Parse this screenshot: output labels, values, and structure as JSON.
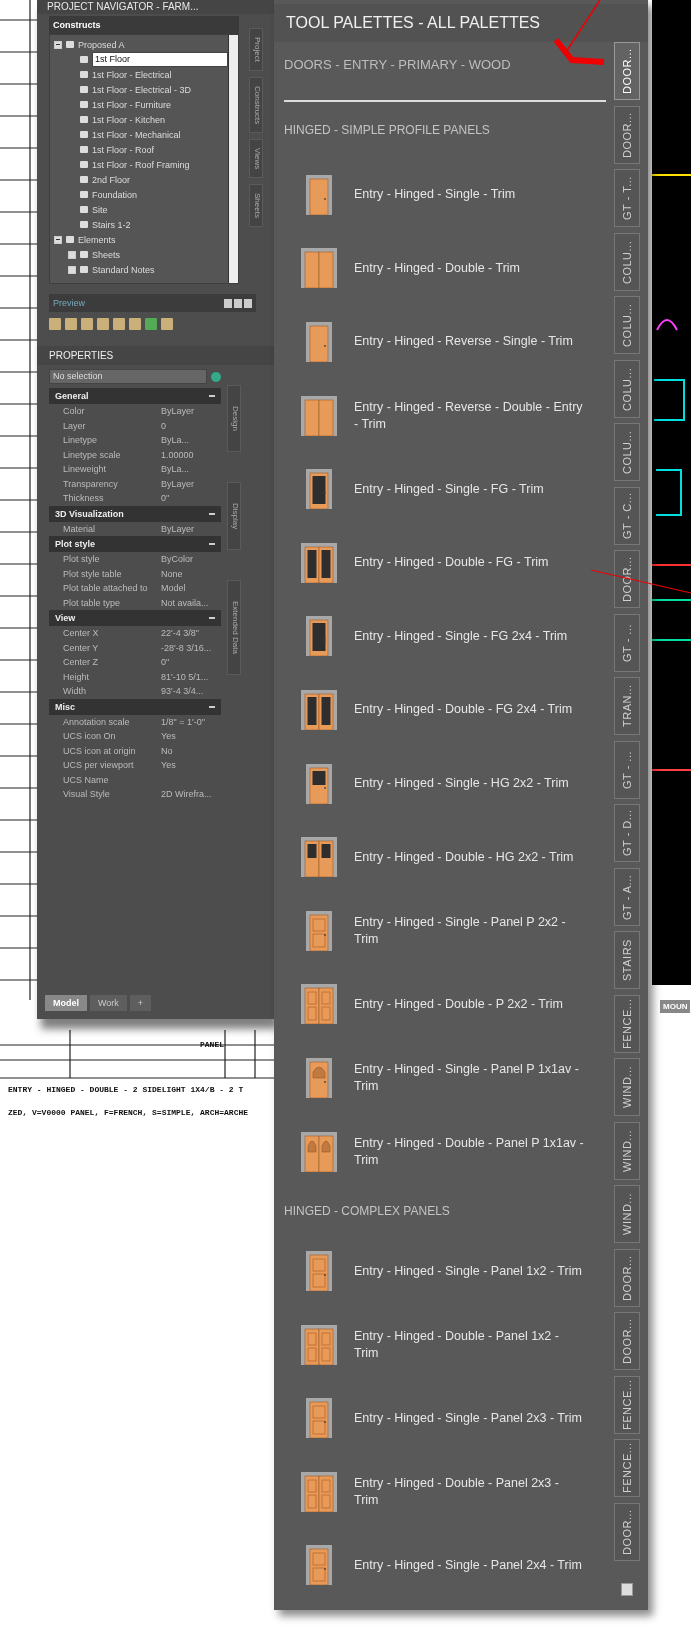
{
  "navigator": {
    "title": "PROJECT NAVIGATOR - FARM...",
    "tab": "Constructs",
    "tree": [
      {
        "label": "Proposed A",
        "expanded": true,
        "selected": false,
        "children": [
          {
            "label": "1st Floor",
            "selected": true
          },
          {
            "label": "1st Floor - Electrical",
            "selected": false
          },
          {
            "label": "1st Floor - Electrical - 3D",
            "selected": false
          },
          {
            "label": "1st Floor - Furniture",
            "selected": false
          },
          {
            "label": "1st Floor - Kitchen",
            "selected": false
          },
          {
            "label": "1st Floor - Mechanical",
            "selected": false
          },
          {
            "label": "1st Floor - Roof",
            "selected": false
          },
          {
            "label": "1st Floor - Roof Framing",
            "selected": false
          },
          {
            "label": "2nd Floor",
            "selected": false
          },
          {
            "label": "Foundation",
            "selected": false
          },
          {
            "label": "Site",
            "selected": false
          },
          {
            "label": "Stairs 1-2",
            "selected": false
          }
        ]
      },
      {
        "label": "Elements",
        "expanded": true,
        "selected": false,
        "children": [
          {
            "label": "Sheets",
            "expanded": false,
            "selected": false
          },
          {
            "label": "Standard Notes",
            "expanded": false,
            "selected": false
          }
        ]
      }
    ],
    "side_tabs": [
      "Project",
      "Constructs",
      "Views",
      "Sheets"
    ],
    "preview": "Preview"
  },
  "properties": {
    "title": "PROPERTIES",
    "selection": "No selection",
    "sections": [
      {
        "name": "General",
        "expanded": true,
        "rows": [
          [
            "Color",
            "ByLayer"
          ],
          [
            "Layer",
            "0"
          ],
          [
            "Linetype",
            "ByLa..."
          ],
          [
            "Linetype scale",
            "1.00000"
          ],
          [
            "Lineweight",
            "ByLa..."
          ],
          [
            "Transparency",
            "ByLayer"
          ],
          [
            "Thickness",
            "0\""
          ]
        ]
      },
      {
        "name": "3D Visualization",
        "expanded": true,
        "rows": [
          [
            "Material",
            "ByLayer"
          ]
        ]
      },
      {
        "name": "Plot style",
        "expanded": true,
        "rows": [
          [
            "Plot style",
            "ByColor"
          ],
          [
            "Plot style table",
            "None"
          ],
          [
            "Plot table attached to",
            "Model"
          ],
          [
            "Plot table type",
            "Not availa..."
          ]
        ]
      },
      {
        "name": "View",
        "expanded": true,
        "rows": [
          [
            "Center X",
            "22'-4 3/8\""
          ],
          [
            "Center Y",
            "-28'-8 3/16..."
          ],
          [
            "Center Z",
            "0\""
          ],
          [
            "Height",
            "81'-10 5/1..."
          ],
          [
            "Width",
            "93'-4 3/4..."
          ]
        ]
      },
      {
        "name": "Misc",
        "expanded": true,
        "rows": [
          [
            "Annotation scale",
            "1/8\" = 1'-0\""
          ],
          [
            "UCS icon On",
            "Yes"
          ],
          [
            "UCS icon at origin",
            "No"
          ],
          [
            "UCS per viewport",
            "Yes"
          ],
          [
            "UCS Name",
            ""
          ],
          [
            "Visual Style",
            "2D Wirefra..."
          ]
        ]
      }
    ],
    "side_tabs": [
      "Design",
      "Display",
      "Extended Data"
    ],
    "layout_tabs": [
      {
        "label": "Model",
        "selected": true
      },
      {
        "label": "Work",
        "selected": false
      },
      {
        "label": "+",
        "selected": false
      }
    ]
  },
  "cad_texts": [
    "PANEL",
    "ENTRY - HINGED - DOUBLE - 2 SIDELIGHT 1X4/B - 2 T",
    "ZED, V=V0000 PANEL, F=FRENCH, S=SIMPLE, ARCH=ARCHE",
    "MOUN"
  ],
  "palette": {
    "title": "TOOL PALETTES - ALL PALETTES",
    "name": "DOORS - ENTRY - PRIMARY - WOOD",
    "groups": [
      {
        "header": "HINGED - SIMPLE PROFILE PANELS",
        "items": [
          {
            "label": "Entry - Hinged - Single - Trim",
            "kind": "single"
          },
          {
            "label": "Entry - Hinged - Double - Trim",
            "kind": "double"
          },
          {
            "label": "Entry - Hinged - Reverse - Single - Trim",
            "kind": "single"
          },
          {
            "label": "Entry - Hinged - Reverse - Double - Entry - Trim",
            "kind": "double"
          },
          {
            "label": "Entry - Hinged - Single - FG - Trim",
            "kind": "single-glass"
          },
          {
            "label": "Entry - Hinged - Double - FG - Trim",
            "kind": "double-glass"
          },
          {
            "label": "Entry - Hinged - Single - FG 2x4 - Trim",
            "kind": "single-glass"
          },
          {
            "label": "Entry - Hinged - Double - FG 2x4 - Trim",
            "kind": "double-glass"
          },
          {
            "label": "Entry - Hinged - Single - HG 2x2 - Trim",
            "kind": "single-halfglass"
          },
          {
            "label": "Entry - Hinged - Double - HG 2x2 - Trim",
            "kind": "double-halfglass"
          },
          {
            "label": "Entry - Hinged - Single - Panel P 2x2 - Trim",
            "kind": "single-panel"
          },
          {
            "label": "Entry - Hinged - Double - P 2x2 - Trim",
            "kind": "double-panel"
          },
          {
            "label": "Entry - Hinged - Single - Panel P 1x1av - Trim",
            "kind": "single-arch"
          },
          {
            "label": "Entry - Hinged - Double - Panel P 1x1av - Trim",
            "kind": "double-arch"
          }
        ]
      },
      {
        "header": "HINGED - COMPLEX PANELS",
        "items": [
          {
            "label": "Entry - Hinged - Single - Panel 1x2 - Trim",
            "kind": "single-panel"
          },
          {
            "label": "Entry - Hinged - Double - Panel 1x2 - Trim",
            "kind": "double-panel"
          },
          {
            "label": "Entry - Hinged - Single - Panel 2x3 - Trim",
            "kind": "single-panel"
          },
          {
            "label": "Entry - Hinged - Double - Panel 2x3 - Trim",
            "kind": "double-panel"
          },
          {
            "label": "Entry - Hinged - Single - Panel 2x4 - Trim",
            "kind": "single-panel"
          }
        ]
      }
    ],
    "tabs": [
      {
        "label": "DOOR...",
        "selected": true
      },
      {
        "label": "DOOR...",
        "selected": false
      },
      {
        "label": "GT - T...",
        "selected": false
      },
      {
        "label": "COLU...",
        "selected": false
      },
      {
        "label": "COLU...",
        "selected": false
      },
      {
        "label": "COLU...",
        "selected": false
      },
      {
        "label": "COLU...",
        "selected": false
      },
      {
        "label": "GT - C...",
        "selected": false
      },
      {
        "label": "DOOR...",
        "selected": false
      },
      {
        "label": "GT - ...",
        "selected": false
      },
      {
        "label": "TRAN...",
        "selected": false
      },
      {
        "label": "GT - ...",
        "selected": false
      },
      {
        "label": "GT - D...",
        "selected": false
      },
      {
        "label": "GT - A...",
        "selected": false
      },
      {
        "label": "STAIRS",
        "selected": false
      },
      {
        "label": "FENCE...",
        "selected": false
      },
      {
        "label": "WIND...",
        "selected": false
      },
      {
        "label": "WIND...",
        "selected": false
      },
      {
        "label": "WIND...",
        "selected": false
      },
      {
        "label": "DOOR...",
        "selected": false
      },
      {
        "label": "DOOR...",
        "selected": false
      },
      {
        "label": "FENCE...",
        "selected": false
      },
      {
        "label": "FENCE...",
        "selected": false
      },
      {
        "label": "DOOR...",
        "selected": false
      }
    ]
  }
}
